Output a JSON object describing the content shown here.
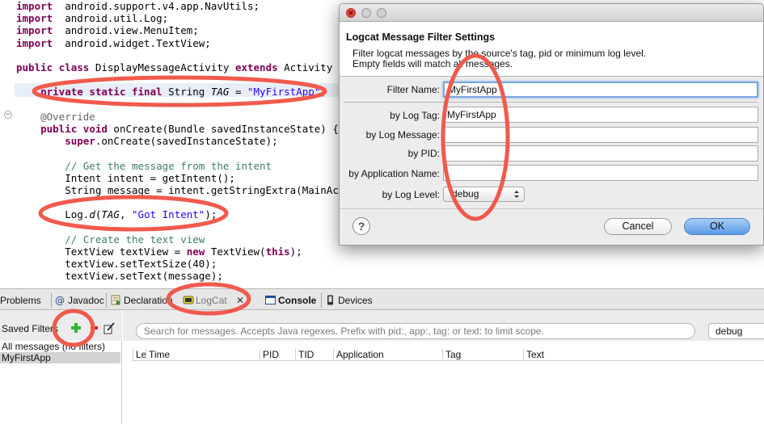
{
  "editor": {
    "lines": [
      {
        "segs": [
          [
            "kw",
            "import"
          ],
          [
            "",
            "  android.support.v4.app.NavUtils;"
          ]
        ]
      },
      {
        "segs": [
          [
            "kw",
            "import"
          ],
          [
            "",
            "  android.util.Log;"
          ]
        ]
      },
      {
        "segs": [
          [
            "kw",
            "import"
          ],
          [
            "",
            "  android.view.MenuItem;"
          ]
        ]
      },
      {
        "segs": [
          [
            "kw",
            "import"
          ],
          [
            "",
            "  android.widget.TextView;"
          ]
        ]
      },
      {
        "segs": []
      },
      {
        "segs": [
          [
            "kw",
            "public class"
          ],
          [
            "",
            " DisplayMessageActivity "
          ],
          [
            "kw",
            "extends"
          ],
          [
            "",
            " Activity {"
          ]
        ]
      },
      {
        "segs": []
      },
      {
        "segs": [
          [
            "",
            "    "
          ],
          [
            "kw",
            "private static final"
          ],
          [
            "",
            " String "
          ],
          [
            "ital",
            "TAG"
          ],
          [
            "",
            " = "
          ],
          [
            "str",
            "\"MyFirstApp\""
          ],
          [
            "",
            ";"
          ]
        ]
      },
      {
        "segs": []
      },
      {
        "segs": [
          [
            "ann",
            "    @Override"
          ]
        ]
      },
      {
        "segs": [
          [
            "",
            "    "
          ],
          [
            "kw",
            "public void"
          ],
          [
            "",
            " onCreate(Bundle savedInstanceState) {"
          ]
        ]
      },
      {
        "segs": [
          [
            "",
            "        "
          ],
          [
            "kw",
            "super"
          ],
          [
            "",
            ".onCreate(savedInstanceState);"
          ]
        ]
      },
      {
        "segs": []
      },
      {
        "segs": [
          [
            "cm",
            "        // Get the message from the intent"
          ]
        ]
      },
      {
        "segs": [
          [
            "",
            "        Intent intent = getIntent();"
          ]
        ]
      },
      {
        "segs": [
          [
            "",
            "        String message = intent.getStringExtra(MainActivi"
          ]
        ]
      },
      {
        "segs": []
      },
      {
        "segs": [
          [
            "",
            "        Log."
          ],
          [
            "ital",
            "d"
          ],
          [
            "",
            "("
          ],
          [
            "ital",
            "TAG"
          ],
          [
            "",
            ", "
          ],
          [
            "str",
            "\"Got Intent\""
          ],
          [
            "",
            ");"
          ]
        ]
      },
      {
        "segs": []
      },
      {
        "segs": [
          [
            "cm",
            "        // Create the text view"
          ]
        ]
      },
      {
        "segs": [
          [
            "",
            "        TextView textView = "
          ],
          [
            "kw",
            "new"
          ],
          [
            "",
            " TextView("
          ],
          [
            "kw",
            "this"
          ],
          [
            "",
            ");"
          ]
        ]
      },
      {
        "segs": [
          [
            "",
            "        textView.setTextSize(40);"
          ]
        ]
      },
      {
        "segs": [
          [
            "",
            "        textView.setText(message);"
          ]
        ]
      }
    ],
    "fold_markers": [
      "−",
      "−"
    ]
  },
  "tabs": [
    {
      "name": "tab-problems",
      "label": "Problems",
      "icon": "problems-icon"
    },
    {
      "name": "tab-javadoc",
      "label": "Javadoc",
      "icon": "javadoc-icon"
    },
    {
      "name": "tab-declaration",
      "label": "Declaration",
      "icon": "declaration-icon"
    },
    {
      "name": "tab-logcat",
      "label": "LogCat",
      "icon": "logcat-icon",
      "close": "✕"
    },
    {
      "name": "tab-console",
      "label": "Console",
      "icon": "console-icon"
    },
    {
      "name": "tab-devices",
      "label": "Devices",
      "icon": "devices-icon"
    }
  ],
  "logcat": {
    "saved_filters_label": "Saved Filters",
    "filters": [
      "All messages (no filters)",
      "MyFirstApp"
    ],
    "search_placeholder": "Search for messages. Accepts Java regexes. Prefix with pid:, app:, tag: or text: to limit scope.",
    "level": "debug",
    "columns": [
      "Level",
      "Time",
      "PID",
      "TID",
      "Application",
      "Tag",
      "Text"
    ]
  },
  "dialog": {
    "title": "Logcat Message Filter Settings",
    "description_line1": "Filter logcat messages by the source's tag, pid or minimum log level.",
    "description_line2": "Empty fields will match all messages.",
    "filter_name_label": "Filter Name:",
    "filter_name_value": "MyFirstApp",
    "log_tag_label": "by Log Tag:",
    "log_tag_value": "MyFirstApp",
    "log_message_label": "by Log Message:",
    "log_message_value": "",
    "pid_label": "by PID:",
    "pid_value": "",
    "app_name_label": "by Application Name:",
    "app_name_value": "",
    "log_level_label": "by Log Level:",
    "log_level_value": "debug",
    "help": "?",
    "cancel": "Cancel",
    "ok": "OK"
  },
  "colors": {
    "annotation": "#f05a4c",
    "keyword": "#7f0055",
    "string": "#2a00ff",
    "comment": "#3f7f5f"
  }
}
